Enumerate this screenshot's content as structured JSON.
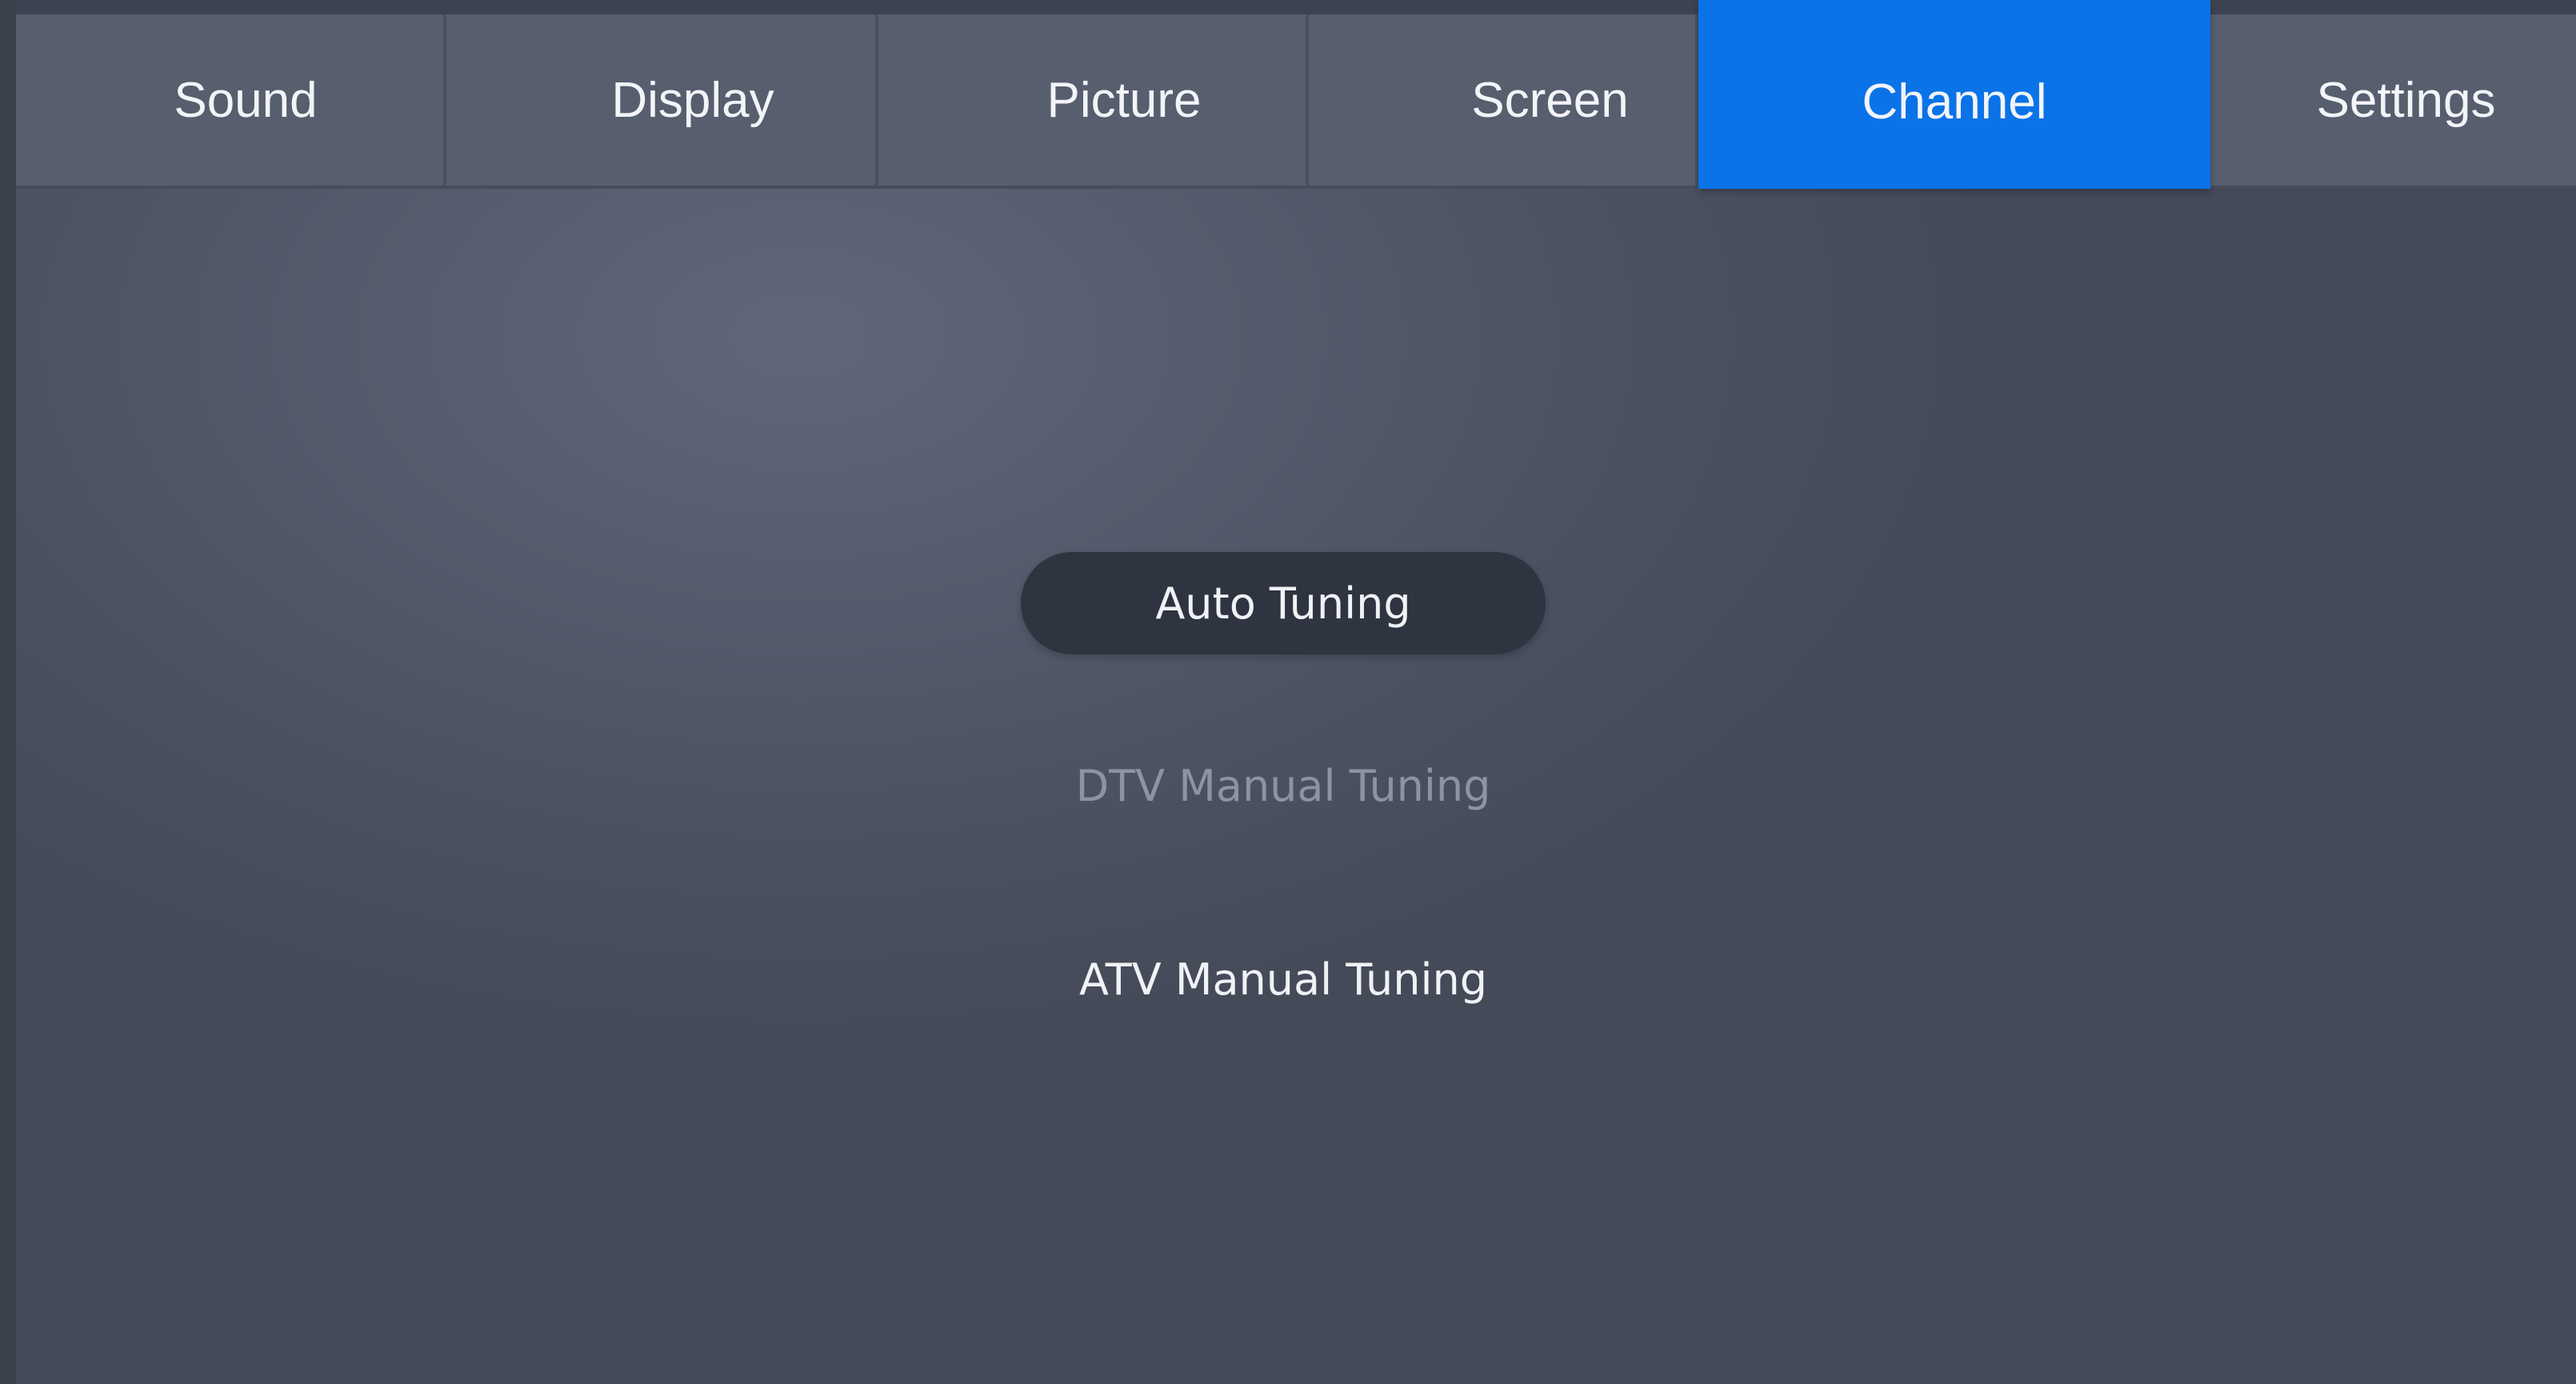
{
  "tabs": [
    {
      "label": "Sound",
      "active": false
    },
    {
      "label": "Display",
      "active": false
    },
    {
      "label": "Picture",
      "active": false
    },
    {
      "label": "Screen",
      "active": false
    },
    {
      "label": "Channel",
      "active": true
    },
    {
      "label": "Settings",
      "active": false
    }
  ],
  "channel_menu": {
    "items": [
      {
        "label": "Auto Tuning",
        "state": "selected"
      },
      {
        "label": "DTV Manual Tuning",
        "state": "disabled"
      },
      {
        "label": "ATV Manual Tuning",
        "state": "enabled"
      }
    ]
  },
  "colors": {
    "active_tab": "#0a73e8",
    "selected_item_bg": "#2f3441",
    "disabled_text": "#8c93a3",
    "background": "#555c6d"
  }
}
